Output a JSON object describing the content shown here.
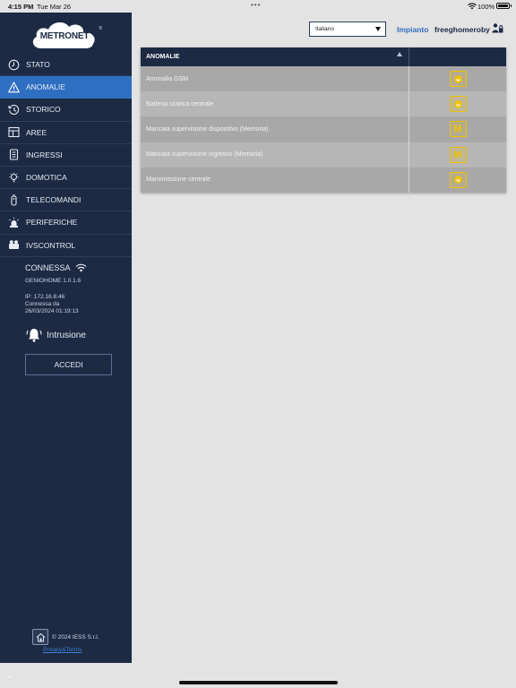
{
  "status_bar": {
    "time": "4:15 PM",
    "date": "Tue Mar 26",
    "battery": "100%"
  },
  "brand": {
    "logo_text": "METRONET",
    "reg_mark": "®"
  },
  "sidebar": {
    "items": [
      {
        "label": "STATO",
        "icon": "clock-icon",
        "active": false
      },
      {
        "label": "ANOMALIE",
        "icon": "warning-icon",
        "active": true
      },
      {
        "label": "STORICO",
        "icon": "history-icon",
        "active": false
      },
      {
        "label": "AREE",
        "icon": "areas-icon",
        "active": false
      },
      {
        "label": "INGRESSI",
        "icon": "sensor-icon",
        "active": false
      },
      {
        "label": "DOMOTICA",
        "icon": "bulb-icon",
        "active": false
      },
      {
        "label": "TELECOMANDI",
        "icon": "remote-icon",
        "active": false
      },
      {
        "label": "PERIFERICHE",
        "icon": "siren-icon",
        "active": false
      },
      {
        "label": "IVSCONTROL",
        "icon": "camera-icon",
        "active": false
      }
    ],
    "connection": {
      "status": "CONNESSA",
      "version": "GENIOHOME 1.0.1.6",
      "ip": "IP: 172.16.8.46",
      "since_label": "Connessa da",
      "since": "26/03/2024 01:19:13"
    },
    "intrusion_label": "Intrusione",
    "login_button": "ACCEDI",
    "footer": {
      "copyright": "© 2024 IESS S.r.l.",
      "links": "Privacy&Terms"
    }
  },
  "header": {
    "language": "Italiano",
    "impianto": "Impianto",
    "username": "freeghomeroby"
  },
  "table": {
    "header": "ANOMALIE",
    "rows": [
      {
        "name": "Anomalia GSM",
        "badge": "icon"
      },
      {
        "name": "Batteria scarica centrale",
        "badge": "icon"
      },
      {
        "name": "Mancata supervisione dispositivo (Memoria)",
        "badge": "M"
      },
      {
        "name": "Mancata supervisione ingresso (Memoria)",
        "badge": "M"
      },
      {
        "name": "Manomissione centrale",
        "badge": "icon"
      }
    ]
  },
  "colors": {
    "sidebar_bg": "#1c2a44",
    "active_item": "#2f6fc1",
    "badge_yellow": "#f2c200"
  }
}
